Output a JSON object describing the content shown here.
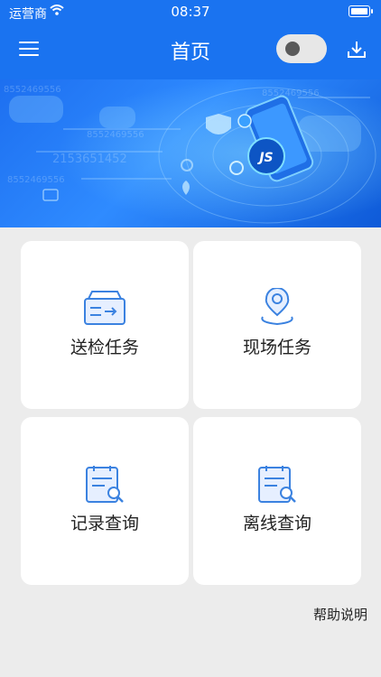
{
  "status_bar": {
    "carrier": "运营商",
    "time": "08:37"
  },
  "header": {
    "title": "首页"
  },
  "banner": {
    "logo_text": "JS",
    "numbers": [
      "8552469556",
      "8552469556",
      "2153651452",
      "8552469556",
      "8552469556"
    ]
  },
  "cards": [
    {
      "label": "送检任务",
      "icon": "inspection-box-icon"
    },
    {
      "label": "现场任务",
      "icon": "location-pin-icon"
    },
    {
      "label": "记录查询",
      "icon": "record-search-icon"
    },
    {
      "label": "离线查询",
      "icon": "offline-search-icon"
    }
  ],
  "footer": {
    "help_label": "帮助说明"
  },
  "colors": {
    "accent": "#1a73f0",
    "icon_blue": "#3b82e0"
  }
}
